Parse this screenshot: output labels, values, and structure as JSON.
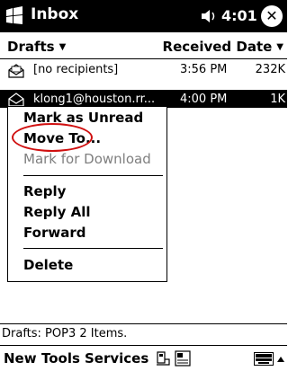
{
  "titlebar": {
    "title": "Inbox",
    "clock": "4:01",
    "close_glyph": "✕",
    "icons": [
      "windows-start-icon",
      "speaker-icon"
    ]
  },
  "header": {
    "folder_label": "Drafts",
    "sort_label": "Received Date",
    "caret": "▼"
  },
  "messages": [
    {
      "icon": "envelope-icon",
      "sender": "[no recipients]",
      "time": "3:56 PM",
      "size": "232K",
      "selected": false
    },
    {
      "icon": "envelope-icon",
      "sender": "klong1@houston.rr...",
      "time": "4:00 PM",
      "size": "1K",
      "selected": true
    }
  ],
  "context_menu": {
    "items": [
      {
        "label": "Mark as Unread",
        "enabled": true
      },
      {
        "label": "Move To...",
        "enabled": true,
        "highlighted": true
      },
      {
        "label": "Mark for Download",
        "enabled": false
      },
      {
        "label": "Reply",
        "enabled": true
      },
      {
        "label": "Reply All",
        "enabled": true
      },
      {
        "label": "Forward",
        "enabled": true
      },
      {
        "label": "Delete",
        "enabled": true
      }
    ]
  },
  "status": {
    "text": "Drafts: POP3  2 Items."
  },
  "command_bar": {
    "new_label": "New",
    "tools_label": "Tools",
    "services_label": "Services",
    "icons": [
      "send-receive-icon",
      "folder-view-icon",
      "keyboard-icon",
      "sip-arrow-icon"
    ]
  },
  "colors": {
    "titlebar_bg": "#000000",
    "selected_bg": "#000000",
    "annotation": "#d01010",
    "disabled_text": "#7f7f7f"
  }
}
